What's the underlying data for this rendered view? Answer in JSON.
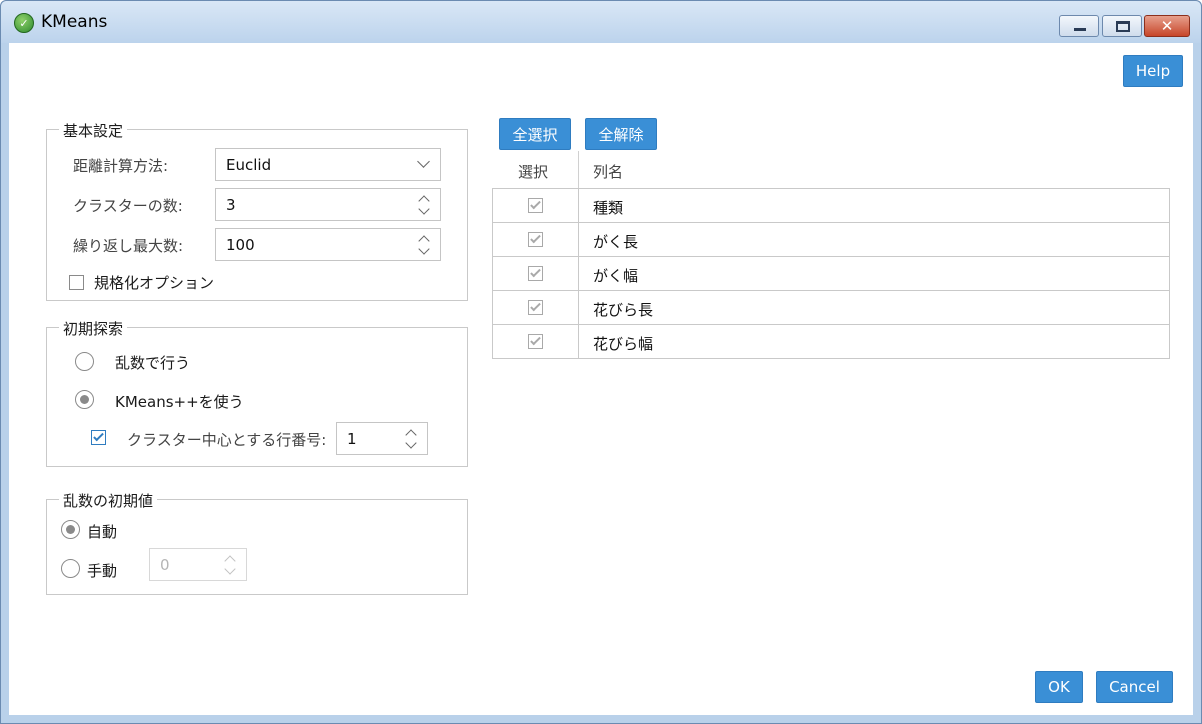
{
  "window": {
    "title": "KMeans",
    "app_icon": "leaf-app-icon",
    "close_glyph": "✕"
  },
  "help_label": "Help",
  "basic": {
    "legend": "基本設定",
    "distance_label": "距離計算方法:",
    "distance_value": "Euclid",
    "clusters_label": "クラスターの数:",
    "clusters_value": "3",
    "maxiter_label": "繰り返し最大数:",
    "maxiter_value": "100",
    "normalize_label": "規格化オプション",
    "normalize_checked": false
  },
  "init": {
    "legend": "初期探索",
    "random_label": "乱数で行う",
    "kmeanspp_label": "KMeans++を使う",
    "center_row_label": "クラスター中心とする行番号:",
    "center_row_value": "1",
    "selected": "kmeanspp"
  },
  "seed": {
    "legend": "乱数の初期値",
    "auto_label": "自動",
    "manual_label": "手動",
    "manual_value": "0",
    "selected": "auto"
  },
  "columns": {
    "select_all_label": "全選択",
    "clear_all_label": "全解除",
    "header_select": "選択",
    "header_name": "列名",
    "rows": [
      {
        "name": "種類",
        "checked": true
      },
      {
        "name": "がく長",
        "checked": true
      },
      {
        "name": "がく幅",
        "checked": true
      },
      {
        "name": "花びら長",
        "checked": true
      },
      {
        "name": "花びら幅",
        "checked": true
      }
    ]
  },
  "footer": {
    "ok_label": "OK",
    "cancel_label": "Cancel"
  },
  "colors": {
    "accent": "#3a8fd6",
    "titlebar": "#bcd3ec",
    "close": "#c7462a"
  }
}
